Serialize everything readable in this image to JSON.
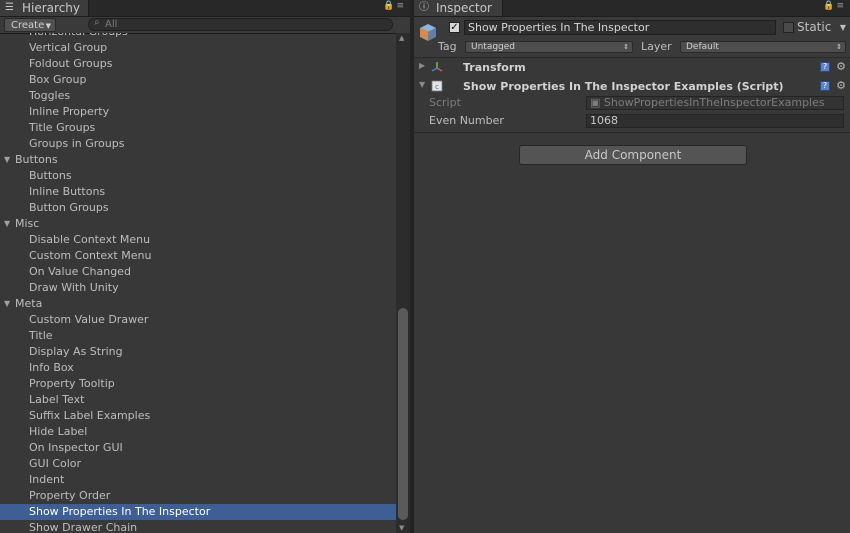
{
  "hierarchy": {
    "tab_title": "Hierarchy",
    "create_label": "Create",
    "search_placeholder": "All",
    "items": [
      {
        "label": "Horizontal Groups",
        "kind": "child"
      },
      {
        "label": "Vertical Group",
        "kind": "child"
      },
      {
        "label": "Foldout Groups",
        "kind": "child"
      },
      {
        "label": "Box Group",
        "kind": "child"
      },
      {
        "label": "Toggles",
        "kind": "child"
      },
      {
        "label": "Inline Property",
        "kind": "child"
      },
      {
        "label": "Title Groups",
        "kind": "child"
      },
      {
        "label": "Groups in Groups",
        "kind": "child"
      },
      {
        "label": "Buttons",
        "kind": "group"
      },
      {
        "label": "Buttons",
        "kind": "child"
      },
      {
        "label": "Inline Buttons",
        "kind": "child"
      },
      {
        "label": "Button Groups",
        "kind": "child"
      },
      {
        "label": "Misc",
        "kind": "group"
      },
      {
        "label": "Disable Context Menu",
        "kind": "child"
      },
      {
        "label": "Custom Context Menu",
        "kind": "child"
      },
      {
        "label": "On Value Changed",
        "kind": "child"
      },
      {
        "label": "Draw With Unity",
        "kind": "child"
      },
      {
        "label": "Meta",
        "kind": "group"
      },
      {
        "label": "Custom Value Drawer",
        "kind": "child"
      },
      {
        "label": "Title",
        "kind": "child"
      },
      {
        "label": "Display As String",
        "kind": "child"
      },
      {
        "label": "Info Box",
        "kind": "child"
      },
      {
        "label": "Property Tooltip",
        "kind": "child"
      },
      {
        "label": "Label Text",
        "kind": "child"
      },
      {
        "label": "Suffix Label Examples",
        "kind": "child"
      },
      {
        "label": "Hide Label",
        "kind": "child"
      },
      {
        "label": "On Inspector GUI",
        "kind": "child"
      },
      {
        "label": "GUI Color",
        "kind": "child"
      },
      {
        "label": "Indent",
        "kind": "child"
      },
      {
        "label": "Property Order",
        "kind": "child"
      },
      {
        "label": "Show Properties In The Inspector",
        "kind": "child",
        "selected": true
      },
      {
        "label": "Show Drawer Chain",
        "kind": "child"
      }
    ]
  },
  "inspector": {
    "tab_title": "Inspector",
    "object_name": "Show Properties In The Inspector",
    "static_label": "Static",
    "tag_label": "Tag",
    "tag_value": "Untagged",
    "layer_label": "Layer",
    "layer_value": "Default",
    "transform_title": "Transform",
    "script_component_title": "Show Properties In The Inspector Examples (Script)",
    "script_label": "Script",
    "script_value": "ShowPropertiesInTheInspectorExamples",
    "even_number_label": "Even Number",
    "even_number_value": "1068",
    "add_component_label": "Add Component"
  },
  "colors": {
    "selection": "#3e5f96",
    "panel_bg": "#383838"
  }
}
